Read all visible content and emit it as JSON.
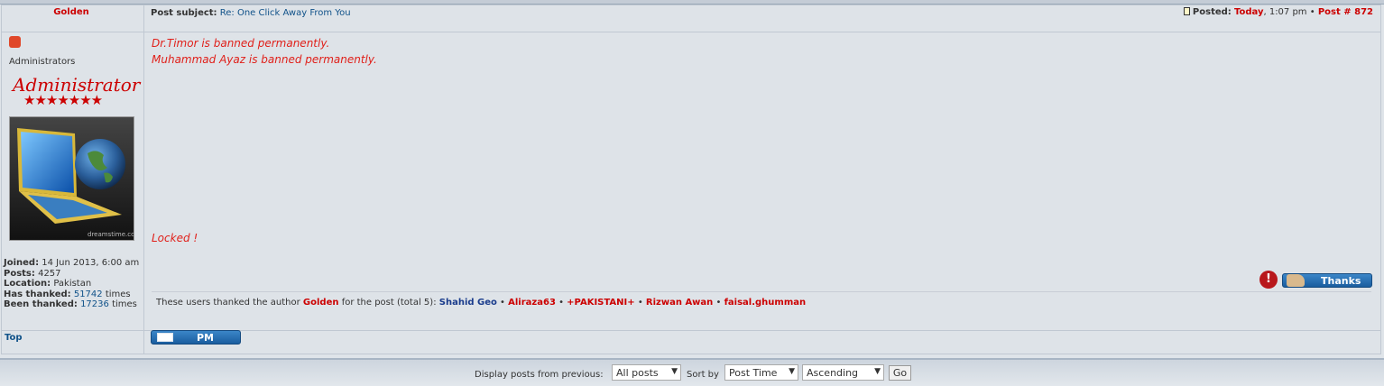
{
  "post": {
    "author": "Golden",
    "subject_label": "Post subject:",
    "subject": "Re: One Click Away From You",
    "posted_label": "Posted:",
    "posted_day": "Today",
    "posted_time": ", 1:07 pm",
    "post_number": "Post # 872"
  },
  "profile": {
    "group": "Administrators",
    "rank": "Administrator",
    "stars": "★★★★★★★",
    "joined_label": "Joined:",
    "joined": "14 Jun 2013, 6:00 am",
    "posts_label": "Posts:",
    "posts": "4257",
    "location_label": "Location:",
    "location": "Pakistan",
    "has_thanked_label": "Has thanked:",
    "has_thanked": "51742",
    "has_thanked_suffix": "times",
    "been_thanked_label": "Been thanked:",
    "been_thanked": "17236",
    "been_thanked_suffix": "times",
    "avatar_watermark": "dreamstime.com"
  },
  "content": {
    "line1": "Dr.Timor is banned permanently.",
    "line2": "Muhammad Ayaz is banned permanently.",
    "line3": "Locked !"
  },
  "thanks": {
    "button_label": "Thanks",
    "prefix": "These users thanked the author",
    "author": "Golden",
    "suffix": "for the post (total 5):",
    "users": [
      "Shahid Geo",
      "Aliraza63",
      "+PAKISTANI+",
      "Rizwan Awan",
      "faisal.ghumman"
    ]
  },
  "actions": {
    "top_link": "Top",
    "pm_label": "PM"
  },
  "footer": {
    "display_label": "Display posts from previous:",
    "display_value": "All posts",
    "sort_label": "Sort by",
    "sort_value": "Post Time",
    "order_value": "Ascending",
    "go_label": "Go"
  },
  "colors": {
    "accent_red": "#cc0000",
    "link_blue": "#105289",
    "button_blue": "#2a72b5"
  }
}
